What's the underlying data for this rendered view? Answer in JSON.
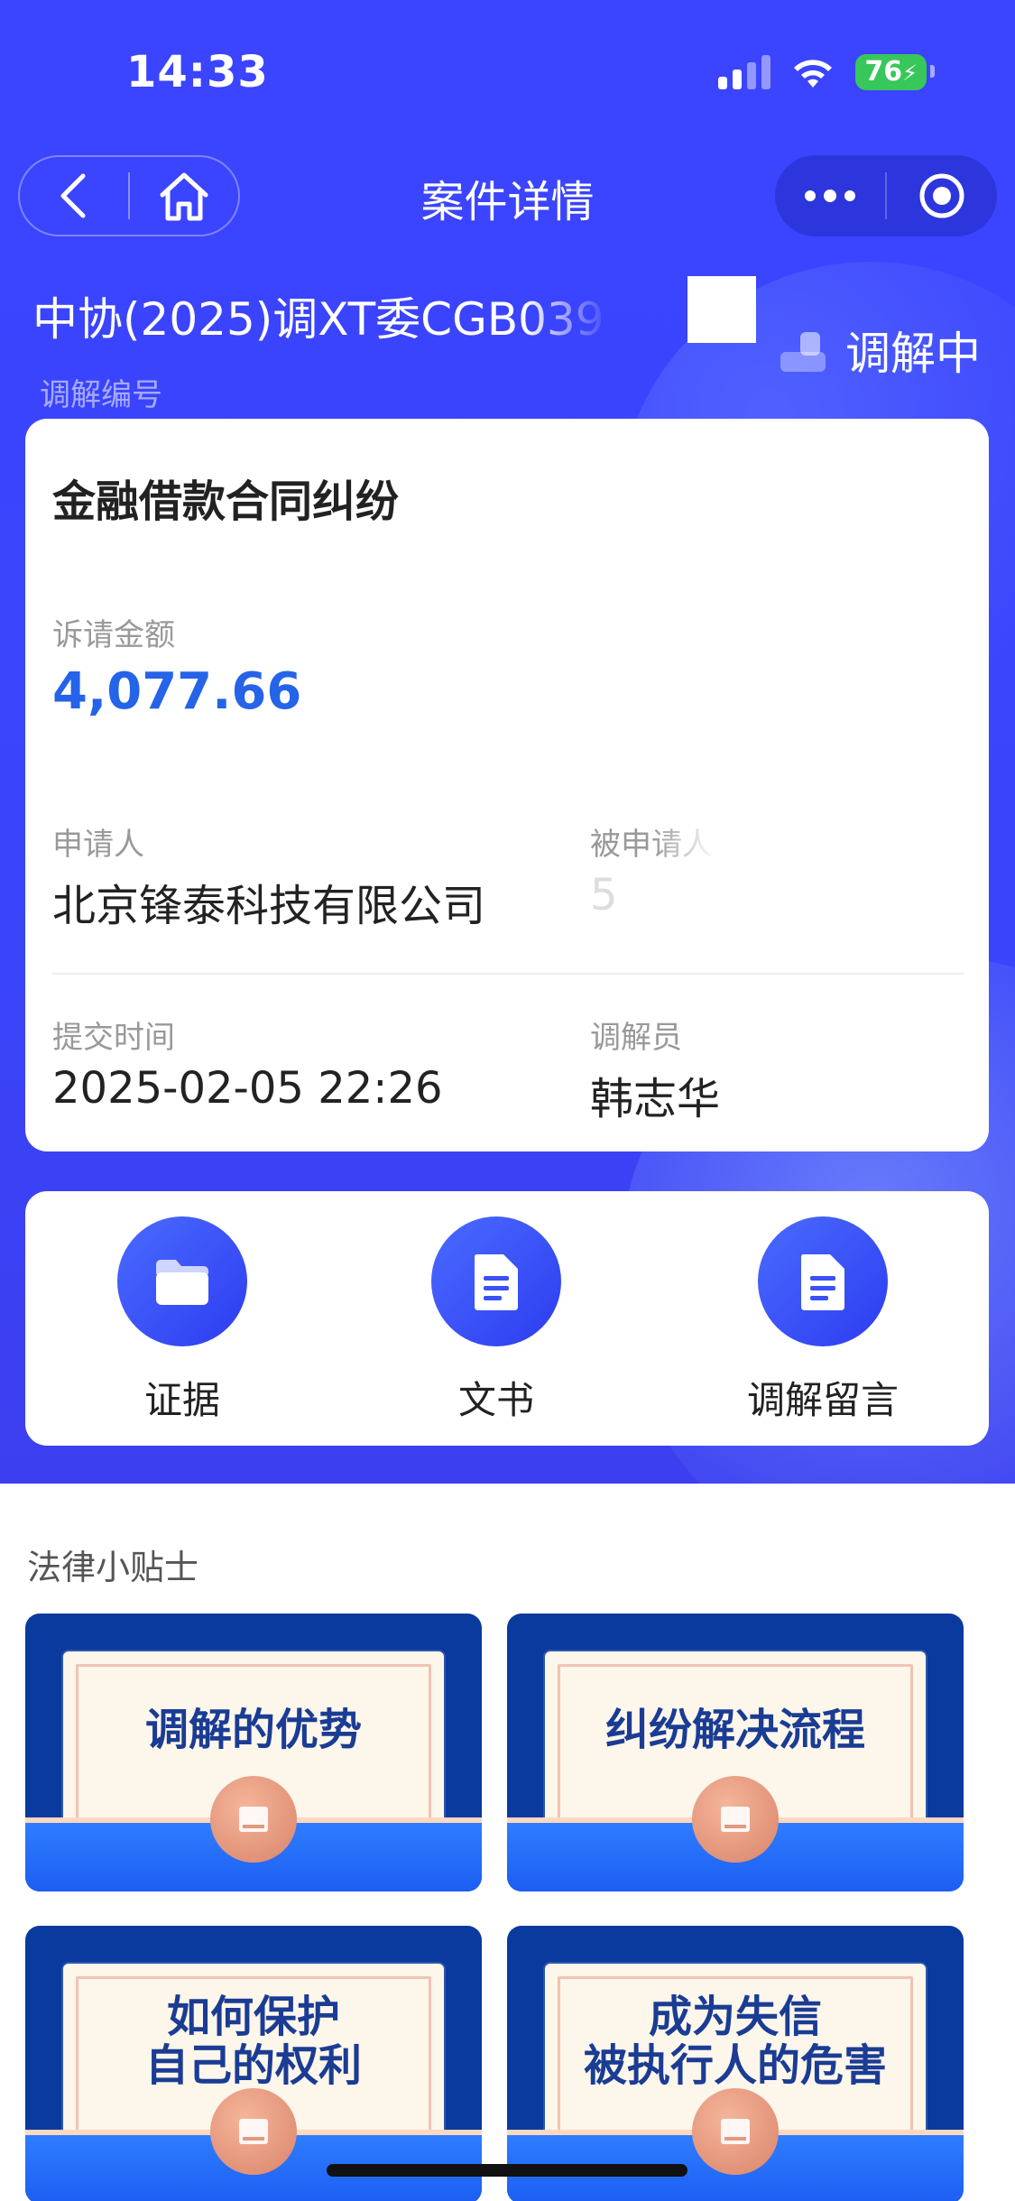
{
  "status_bar": {
    "time": "14:33",
    "battery": "76"
  },
  "nav": {
    "title": "案件详情"
  },
  "case": {
    "number": "中协(2025)调XT委CGB039",
    "number_label": "调解编号",
    "status": "调解中",
    "title": "金融借款合同纠纷",
    "amount_label": "诉请金额",
    "amount": "4,077.66",
    "applicant_label": "申请人",
    "applicant": "北京锋泰科技有限公司",
    "respondent_label": "被申请人",
    "respondent": "5",
    "submit_time_label": "提交时间",
    "submit_time": "2025-02-05 22:26",
    "mediator_label": "调解员",
    "mediator": "韩志华"
  },
  "actions": [
    {
      "label": "证据",
      "icon": "folder-icon"
    },
    {
      "label": "文书",
      "icon": "document-icon"
    },
    {
      "label": "调解留言",
      "icon": "document-icon"
    }
  ],
  "tips": {
    "title": "法律小贴士",
    "items": [
      {
        "line1": "调解的优势",
        "line2": ""
      },
      {
        "line1": "纠纷解决流程",
        "line2": ""
      },
      {
        "line1": "如何保护",
        "line2": "自己的权利"
      },
      {
        "line1": "成为失信",
        "line2": "被执行人的危害"
      }
    ]
  },
  "colors": {
    "brand": "#3b44ff",
    "amount": "#2563e8",
    "battery": "#37c75a",
    "tip_text": "#1a3c94"
  }
}
